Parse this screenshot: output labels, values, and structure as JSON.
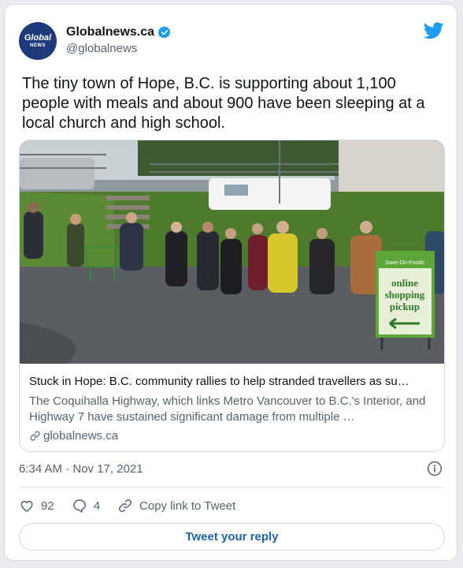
{
  "tweet": {
    "author": {
      "display_name": "Globalnews.ca",
      "handle": "@globalnews",
      "verified": true,
      "avatar_text_top": "Global",
      "avatar_text_bottom": "NEWS",
      "avatar_color": "#1e3a7b"
    },
    "text": "The tiny town of Hope, B.C. is supporting about 1,100 people with meals and about 900 have been sleeping at a local church and high school.",
    "link_card": {
      "image_icon": "photo-people-lining-up",
      "sign_brand": "Save-On-Foods",
      "sign_text": [
        "online",
        "shopping",
        "pickup"
      ],
      "title": "Stuck in Hope: B.C. community rallies to help stranded travellers as su…",
      "description": "The Coquihalla Highway, which links Metro Vancouver to B.C.'s Interior, and Highway 7 have sustained significant damage from multiple …",
      "domain": "globalnews.ca"
    },
    "timestamp": "6:34 AM · Nov 17, 2021",
    "actions": {
      "likes": "92",
      "replies": "4",
      "copy_link_label": "Copy link to Tweet"
    },
    "reply_button_label": "Tweet your reply",
    "colors": {
      "twitter_blue": "#1d9bf0",
      "reply_text": "#1d64a9",
      "secondary_text": "#536471"
    }
  }
}
